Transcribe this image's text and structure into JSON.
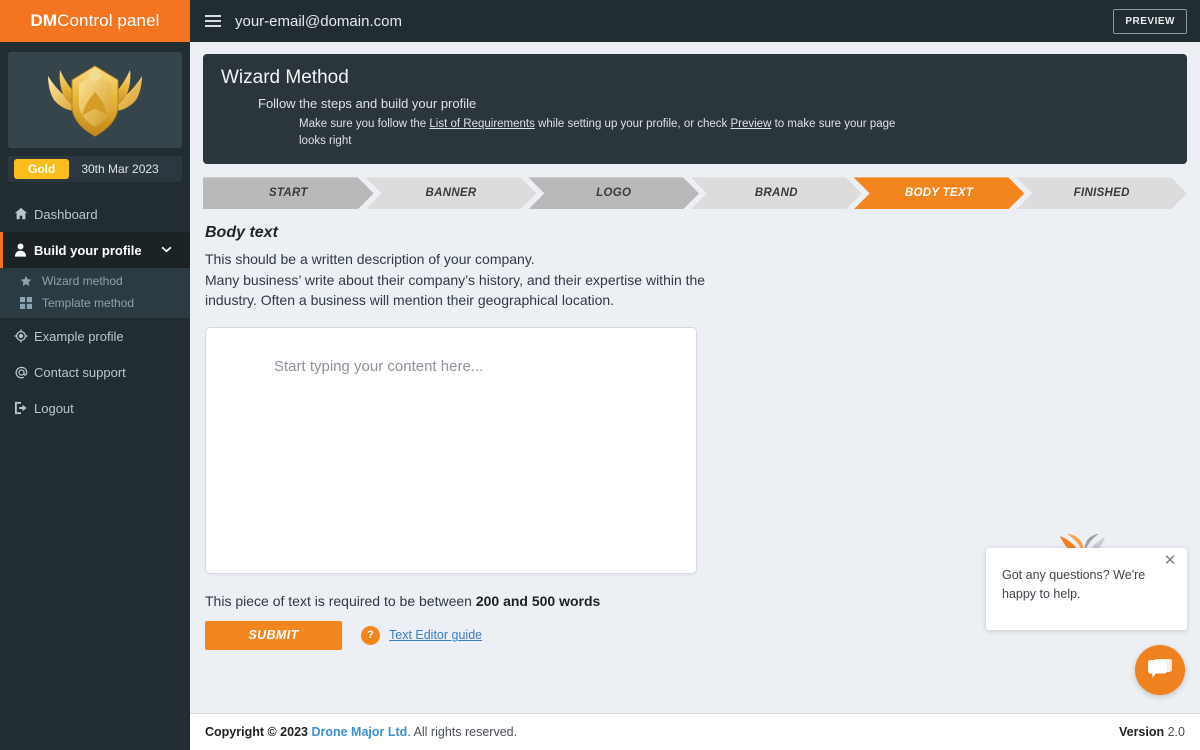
{
  "brand": {
    "bold": "DM",
    "normal": "Control panel"
  },
  "header": {
    "hamburger_icon": "hamburger-icon",
    "user_email": "your-email@domain.com",
    "preview_label": "PREVIEW"
  },
  "sidebar": {
    "crest_icon": "gold-wing-crest-badge",
    "tier_label": "Gold",
    "tier_date": "30th Mar 2023",
    "items": [
      {
        "label": "Dashboard",
        "icon": "home-icon"
      },
      {
        "label": "Build your profile",
        "icon": "user-icon",
        "chevron": "chevron-down-icon",
        "active": true
      },
      {
        "label": "Example profile",
        "icon": "target-icon"
      },
      {
        "label": "Contact support",
        "icon": "at-icon"
      },
      {
        "label": "Logout",
        "icon": "logout-icon"
      }
    ],
    "submenu": [
      {
        "label": "Wizard method",
        "icon": "star-icon"
      },
      {
        "label": "Template method",
        "icon": "grid-icon"
      }
    ]
  },
  "wizard": {
    "title": "Wizard Method",
    "subtitle": "Follow the steps and build your profile",
    "desc_part1": "Make sure you follow the ",
    "desc_link1": "List of Requirements",
    "desc_part2": " while setting up your profile, or check ",
    "desc_link2": "Preview",
    "desc_part3": " to make sure your page looks right"
  },
  "steps": [
    {
      "label": "START",
      "state": "gray-dark"
    },
    {
      "label": "BANNER",
      "state": "gray-light"
    },
    {
      "label": "LOGO",
      "state": "gray-dark"
    },
    {
      "label": "BRAND",
      "state": "gray-light"
    },
    {
      "label": "BODY TEXT",
      "state": "orange"
    },
    {
      "label": "FINISHED",
      "state": "gray-light"
    }
  ],
  "body_section": {
    "title": "Body text",
    "para1": "This should be a written description of your company.",
    "para2": "Many business’ write about their company’s history, and their expertise within the industry. Often a business will mention their geographical location.",
    "textarea_placeholder": "Start typing your content here...",
    "textarea_value": "",
    "word_req_prefix": "This piece of text is required to be between ",
    "word_req_bold": "200 and 500 words",
    "submit_label": "SUBMIT",
    "help_icon_label": "?",
    "editor_guide_label": "Text Editor guide"
  },
  "chat": {
    "bird_icon": "falcon-logo-icon",
    "message": "Got any questions? We're happy to help.",
    "close_icon": "close-icon",
    "button_icon": "chat-bubble-icon"
  },
  "footer": {
    "copyright_prefix": "Copyright © 2023 ",
    "company": "Drone Major Ltd",
    "copyright_suffix": ". All rights reserved.",
    "version_label": "Version ",
    "version_value": "2.0"
  },
  "colors": {
    "brand_orange": "#f37421",
    "sidebar_dark": "#222d32",
    "panel_dark": "#2a353c",
    "accent_blue": "#3b8fd4",
    "gold": "#fcbe1f"
  }
}
